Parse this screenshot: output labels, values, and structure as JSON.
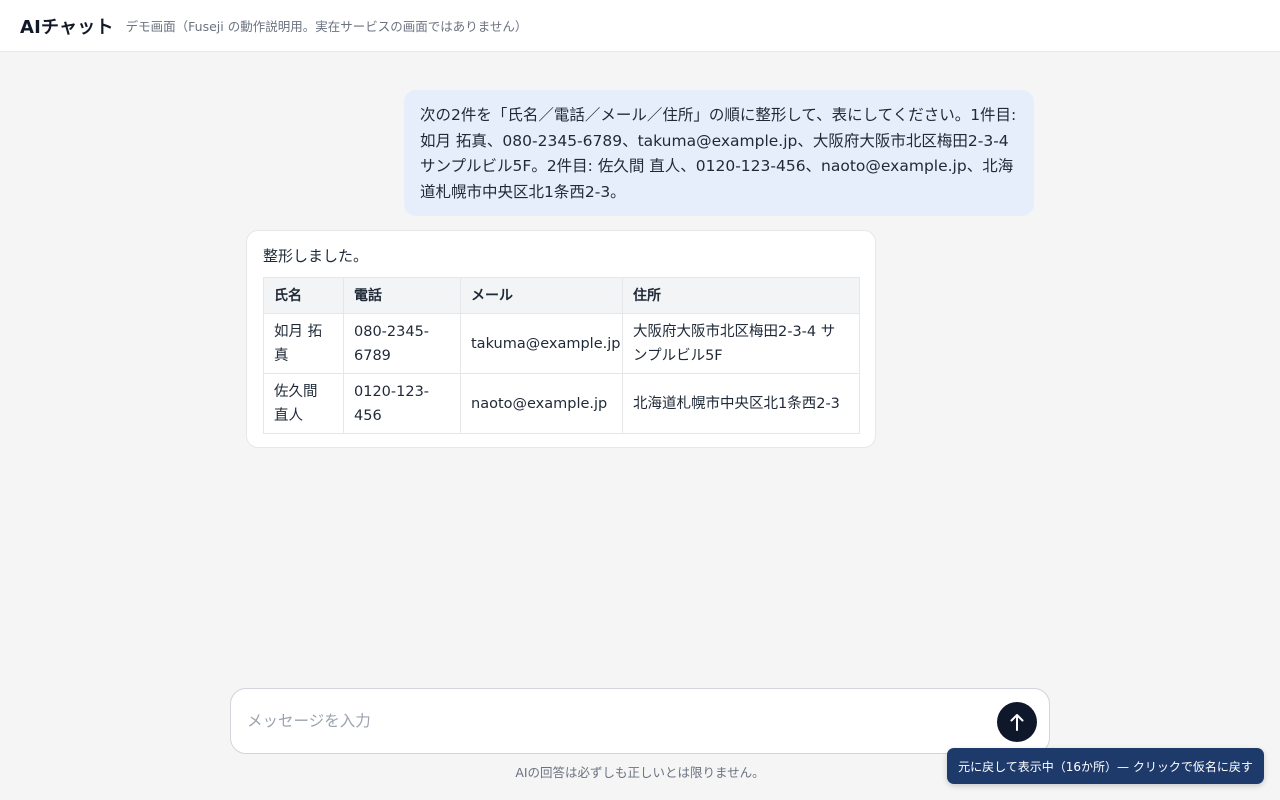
{
  "header": {
    "title": "AIチャット",
    "subtitle": "デモ画面（Fuseji の動作説明用。実在サービスの画面ではありません）"
  },
  "messages": {
    "user_text": "次の2件を「氏名／電話／メール／住所」の順に整形して、表にしてください。1件目: 如月 拓真、080-2345-6789、takuma@example.jp、大阪府大阪市北区梅田2-3-4 サンプルビル5F。2件目: 佐久間 直人、0120-123-456、naoto@example.jp、北海道札幌市中央区北1条西2-3。",
    "assistant_intro": "整形しました。",
    "table": {
      "headers": [
        "氏名",
        "電話",
        "メール",
        "住所"
      ],
      "rows": [
        [
          "如月 拓真",
          "080-2345-6789",
          "takuma@example.jp",
          "大阪府大阪市北区梅田2-3-4 サンプルビル5F"
        ],
        [
          "佐久間 直人",
          "0120-123-456",
          "naoto@example.jp",
          "北海道札幌市中央区北1条西2-3"
        ]
      ]
    }
  },
  "composer": {
    "placeholder": "メッセージを入力",
    "value": "",
    "send_icon": "arrow-up-icon"
  },
  "disclaimer": "AIの回答は必ずしも正しいとは限りません。",
  "toast": {
    "label": "元に戻して表示中（16か所）— クリックで仮名に戻す"
  },
  "colors": {
    "user_bubble": "#e7eefb",
    "send_button": "#0f172a",
    "toast_background": "#1e3a6b",
    "page_background": "#f5f5f5"
  }
}
